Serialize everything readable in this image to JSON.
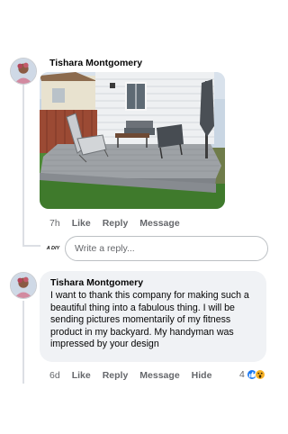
{
  "comment1": {
    "author": "Tishara Montgomery",
    "time": "7h",
    "like_label": "Like",
    "reply_label": "Reply",
    "message_label": "Message"
  },
  "reply": {
    "avatar_text": "A DIY",
    "placeholder": "Write a reply..."
  },
  "comment2": {
    "author": "Tishara Montgomery",
    "text": "I want to thank this company for making such a beautiful thing into a fabulous thing. I will be sending pictures momentarily of my fitness product in my backyard. My handyman was impressed by your design",
    "time": "6d",
    "like_label": "Like",
    "reply_label": "Reply",
    "message_label": "Message",
    "hide_label": "Hide",
    "reaction_count": "4",
    "reaction_icons": [
      "like-icon",
      "wow-icon"
    ]
  },
  "colors": {
    "bubble": "#f0f2f5",
    "secondary_text": "#65676b",
    "like_blue": "#1877f2",
    "wow_yellow": "#f7b125"
  }
}
